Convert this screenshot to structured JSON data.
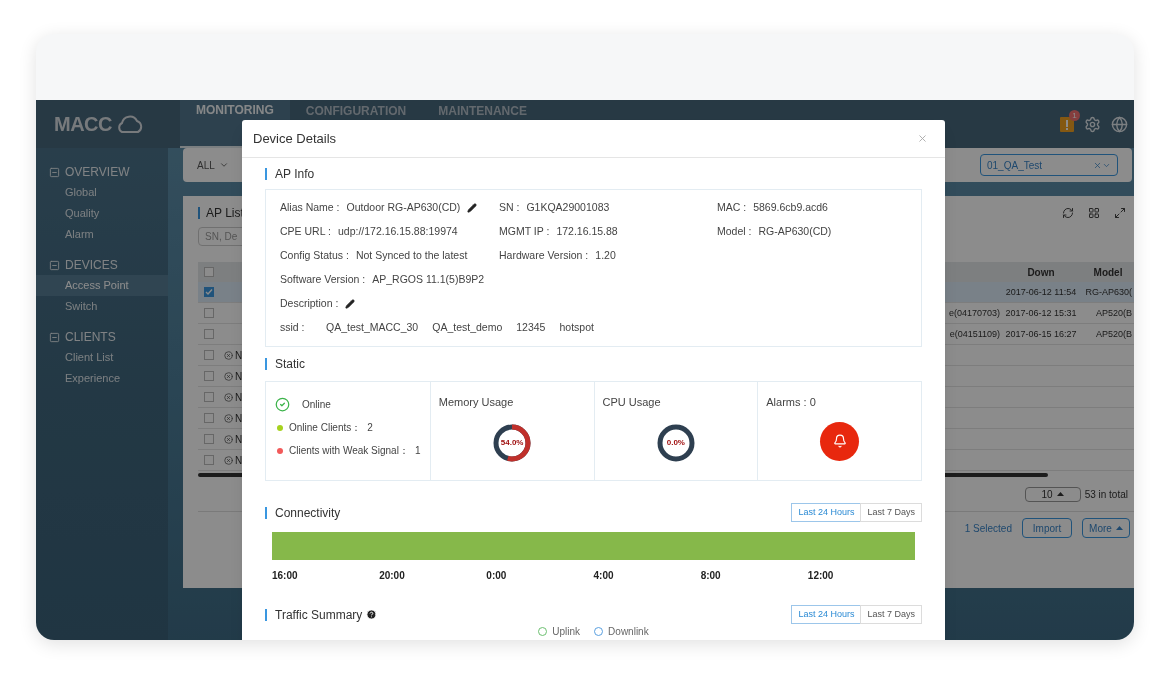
{
  "app": {
    "logo": "MACC",
    "nav_tabs": [
      {
        "label": "MONITORING",
        "selected": true
      },
      {
        "label": "CONFIGURATION",
        "selected": false
      },
      {
        "label": "MAINTENANCE",
        "selected": false
      }
    ],
    "alert_badge": "1",
    "sidebar": [
      {
        "title": "OVERVIEW",
        "items": [
          {
            "label": "Global",
            "selected": false
          },
          {
            "label": "Quality",
            "selected": false
          },
          {
            "label": "Alarm",
            "selected": false
          }
        ]
      },
      {
        "title": "DEVICES",
        "items": [
          {
            "label": "Access Point",
            "selected": true
          },
          {
            "label": "Switch",
            "selected": false
          }
        ]
      },
      {
        "title": "CLIENTS",
        "items": [
          {
            "label": "Client List",
            "selected": false
          },
          {
            "label": "Experience",
            "selected": false
          }
        ]
      }
    ],
    "filter": {
      "scope": "ALL",
      "group": "01_QA_Test"
    },
    "ap_list": {
      "title": "AP List",
      "search_placeholder": "SN, De",
      "header_checked": false,
      "columns": [
        "Down",
        "Model"
      ],
      "rows": [
        {
          "checked": true,
          "selected": true,
          "down": "2017-06-12 11:54",
          "model": "RG-AP630("
        },
        {
          "checked": false,
          "selected": false,
          "column_tail": "e(04170703)",
          "down": "2017-06-12 15:31",
          "model": "AP520(B"
        },
        {
          "checked": false,
          "selected": false,
          "column_tail": "e(04151109)",
          "down": "2017-06-15 16:27",
          "model": "AP520(B"
        },
        {
          "checked": false,
          "selected": false,
          "status": "N"
        },
        {
          "checked": false,
          "selected": false,
          "status": "N"
        },
        {
          "checked": false,
          "selected": false,
          "status": "N"
        },
        {
          "checked": false,
          "selected": false,
          "status": "N"
        },
        {
          "checked": false,
          "selected": false,
          "status": "N"
        },
        {
          "checked": false,
          "selected": false,
          "status": "N"
        }
      ],
      "page_size": "10",
      "total": "53 in total",
      "selected_count": "1 Selected",
      "buttons": [
        "Import",
        "More"
      ]
    }
  },
  "dialog": {
    "title": "Device Details",
    "ap_info": {
      "title": "AP Info",
      "rows": [
        [
          {
            "label": "Alias Name :",
            "value": "Outdoor RG-AP630(CD)",
            "editable": true
          },
          {
            "label": "SN :",
            "value": "G1KQA29001083"
          },
          {
            "label": "MAC :",
            "value": "5869.6cb9.acd6"
          }
        ],
        [
          {
            "label": "CPE URL :",
            "value": "udp://172.16.15.88:19974"
          },
          {
            "label": "MGMT IP :",
            "value": "172.16.15.88"
          },
          {
            "label": "Model :",
            "value": "RG-AP630(CD)"
          }
        ],
        [
          {
            "label": "Config Status :",
            "value": "Not Synced to the latest"
          },
          {
            "label": "Hardware Version :",
            "value": "1.20"
          }
        ],
        [
          {
            "label": "Software Version :",
            "value": "AP_RGOS 11.1(5)B9P2"
          }
        ],
        [
          {
            "label": "Description :",
            "editable": true
          }
        ]
      ],
      "ssid": {
        "label": "ssid :",
        "values": [
          "QA_test_MACC_30",
          "QA_test_demo",
          "12345",
          "hotspot"
        ]
      }
    },
    "static": {
      "title": "Static",
      "status": "Online",
      "clients": [
        {
          "label": "Online Clients：",
          "value": "2",
          "color": "#a6d21e"
        },
        {
          "label": "Clients with Weak Signal：",
          "value": "1",
          "color": "#f25a5a"
        }
      ],
      "usage": [
        {
          "title": "Memory Usage",
          "reading": "54.0%",
          "level": 0.54
        },
        {
          "title": "CPU Usage",
          "reading": "0.0%",
          "level": 0
        }
      ],
      "alarms": "Alarms : 0"
    },
    "connectivity": {
      "title": "Connectivity",
      "ranges": [
        {
          "label": "Last 24 Hours",
          "selected": true
        },
        {
          "label": "Last 7 Days",
          "selected": false
        }
      ],
      "times": [
        "16:00",
        "20:00",
        "0:00",
        "4:00",
        "8:00",
        "12:00"
      ]
    },
    "traffic": {
      "title": "Traffic Summary",
      "ranges": [
        {
          "label": "Last 24 Hours",
          "selected": true
        },
        {
          "label": "Last 7 Days",
          "selected": false
        }
      ],
      "legend": [
        "Uplink",
        "Downlink"
      ]
    }
  }
}
